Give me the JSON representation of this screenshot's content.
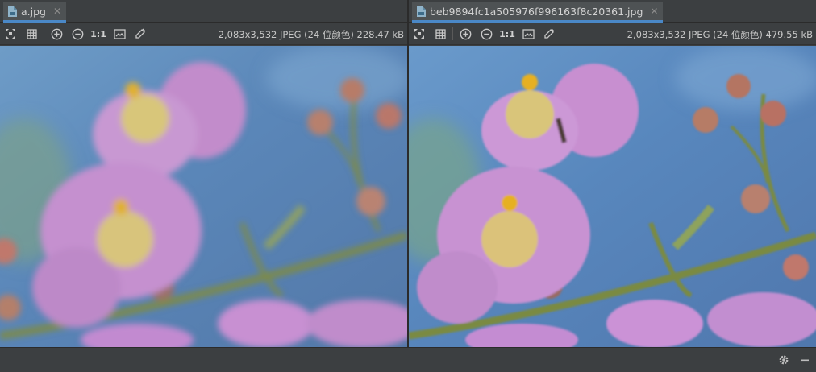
{
  "left": {
    "tab": {
      "label": "a.jpg",
      "close": "✕"
    },
    "info": "2,083x3,532 JPEG (24 位颜色) 228.47 kB",
    "toolbar": {
      "actual_size_label": "1:1"
    }
  },
  "right": {
    "tab": {
      "label": "beb9894fc1a505976f996163f8c20361.jpg",
      "close": "✕"
    },
    "info": "2,083x3,532 JPEG (24 位颜色) 479.55 kB",
    "toolbar": {
      "actual_size_label": "1:1"
    }
  },
  "colors": {
    "accent": "#4a88c7",
    "sky": "#5b86b8",
    "petal": "#c88fd0",
    "stem": "#7d8a4a"
  },
  "icons": [
    "jpg-file-icon",
    "close-icon",
    "fit-zoom-icon",
    "grid-icon",
    "zoom-in-icon",
    "zoom-out-icon",
    "frame-icon",
    "color-picker-icon",
    "gear-icon",
    "minimize-icon"
  ]
}
